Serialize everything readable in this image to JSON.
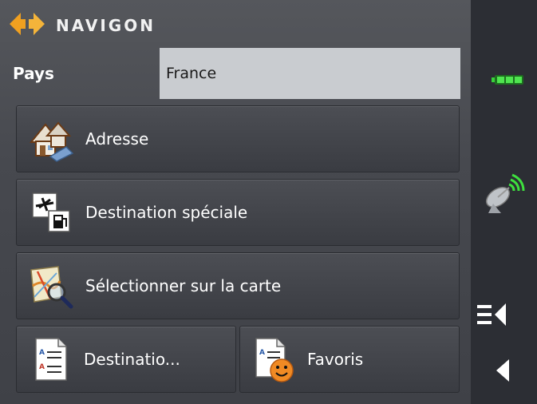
{
  "header": {
    "brand": "NAVIGON",
    "logo_icon": "navigon-arrows-logo"
  },
  "country": {
    "label": "Pays",
    "value": "France"
  },
  "menu": {
    "address": {
      "label": "Adresse",
      "icon": "house-icon"
    },
    "poi": {
      "label": "Destination spéciale",
      "icon": "poi-fuel-icon"
    },
    "map": {
      "label": "Sélectionner sur la carte",
      "icon": "map-magnifier-icon"
    },
    "last": {
      "label": "Destinatio...",
      "icon": "document-list-icon"
    },
    "favorites": {
      "label": "Favoris",
      "icon": "favorites-smiley-icon"
    }
  },
  "sidebar": {
    "battery_icon": "battery-icon",
    "gps_icon": "gps-satellite-icon",
    "menu_icon": "menu-back-icon",
    "back_icon": "back-arrow-icon"
  },
  "colors": {
    "panel": "#4a4c52",
    "sidebar": "#2c2e34",
    "field": "#c9ccd0",
    "logo_orange": "#f0a020",
    "battery_green": "#39d13a"
  }
}
